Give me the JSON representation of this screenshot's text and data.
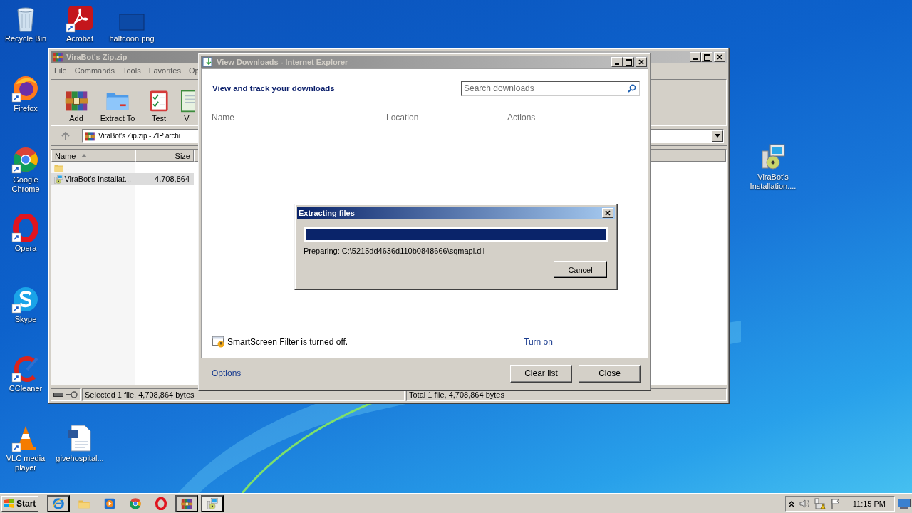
{
  "desktop_icons": [
    {
      "kind": "recycle",
      "label": "Recycle Bin",
      "shortcut": false
    },
    {
      "kind": "acrobat",
      "label": "Acrobat",
      "shortcut": true
    },
    {
      "kind": "image",
      "label": "halfcoon.png",
      "shortcut": false
    },
    {
      "kind": "firefox",
      "label": "Firefox",
      "shortcut": true
    },
    {
      "kind": "chrome",
      "label": "Google Chrome",
      "shortcut": true
    },
    {
      "kind": "opera",
      "label": "Opera",
      "shortcut": true
    },
    {
      "kind": "skype",
      "label": "Skype",
      "shortcut": true
    },
    {
      "kind": "ccleaner",
      "label": "CCleaner",
      "shortcut": true
    },
    {
      "kind": "vlc",
      "label": "VLC media player",
      "shortcut": true
    },
    {
      "kind": "document",
      "label": "givehospital...",
      "shortcut": false
    },
    {
      "kind": "installer",
      "label": "ViraBot's Installation....",
      "shortcut": false
    }
  ],
  "winrar_window": {
    "title": "ViraBot's Zip.zip",
    "menu": [
      "File",
      "Commands",
      "Tools",
      "Favorites",
      "Op"
    ],
    "toolbar": [
      {
        "kind": "add",
        "label": "Add"
      },
      {
        "kind": "extract",
        "label": "Extract To"
      },
      {
        "kind": "test",
        "label": "Test"
      },
      {
        "kind": "view",
        "label": "Vi"
      }
    ],
    "address": "ViraBot's Zip.zip - ZIP archi",
    "columns": [
      "Name",
      "Size"
    ],
    "rows": [
      {
        "kind": "parent",
        "name": "..",
        "selected": false
      },
      {
        "kind": "installer",
        "name": "ViraBot's Installat...",
        "size": "4,708,864",
        "selected": true
      }
    ],
    "status_selected": "Selected 1 file, 4,708,864 bytes",
    "status_total": "Total 1 file, 4,708,864 bytes"
  },
  "downloads_window": {
    "title": "View Downloads - Internet Explorer",
    "heading": "View and track your downloads",
    "search": {
      "placeholder": "Search downloads"
    },
    "columns": [
      "Name",
      "Location",
      "Actions"
    ],
    "smartscreen": {
      "message": "SmartScreen Filter is turned off.",
      "link": "Turn on"
    },
    "options_link": "Options",
    "buttons": [
      "Clear list",
      "Close"
    ]
  },
  "extract_dialog": {
    "title": "Extracting files",
    "level": 1,
    "status": "Preparing: C:\\5215dd4636d110b0848666\\sqmapi.dll",
    "button": "Cancel"
  },
  "taskbar": {
    "start": "Start",
    "buttons": [
      {
        "kind": "ie",
        "task": true,
        "selected": false
      },
      {
        "kind": "folder",
        "task": false,
        "selected": false
      },
      {
        "kind": "media",
        "task": false,
        "selected": false
      },
      {
        "kind": "chrome",
        "task": false,
        "selected": false
      },
      {
        "kind": "opera",
        "task": false,
        "selected": false
      },
      {
        "kind": "winrar",
        "task": true,
        "selected": false
      },
      {
        "kind": "installer",
        "task": true,
        "selected": true
      }
    ],
    "clock": "11:15 PM"
  }
}
